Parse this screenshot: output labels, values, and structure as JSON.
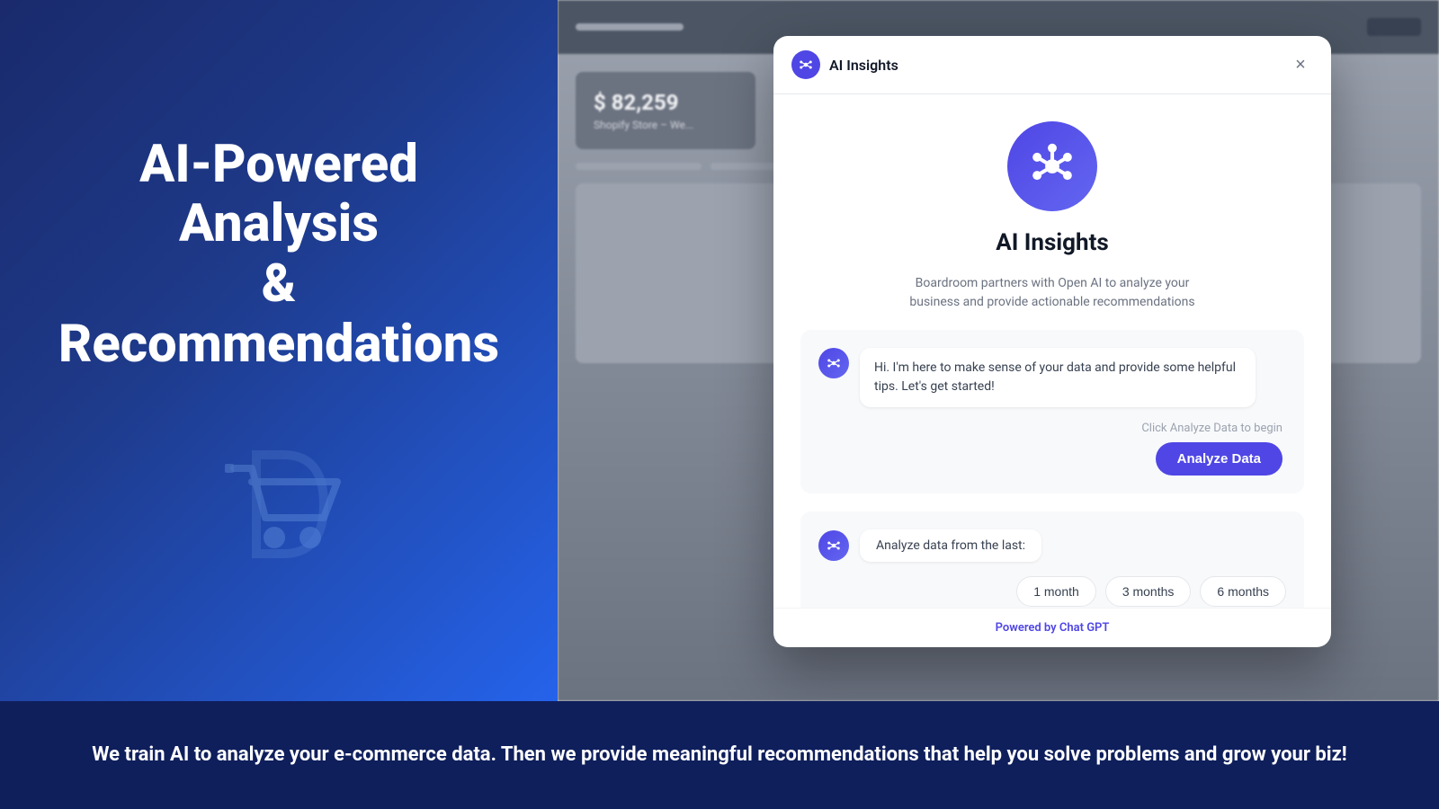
{
  "left_panel": {
    "heading_line1": "AI-Powered",
    "heading_line2": "Analysis",
    "heading_line3": "&",
    "heading_line4": "Recommendations"
  },
  "modal": {
    "header": {
      "title": "AI Insights",
      "close_label": "×"
    },
    "icon_alt": "ai-insights-icon",
    "main_title": "AI Insights",
    "subtitle": "Boardroom partners with Open AI to analyze your business and provide actionable recommendations",
    "chat_message_1": "Hi. I'm here to make sense of your data and provide some helpful tips. Let's get started!",
    "click_hint": "Click Analyze Data to begin",
    "analyze_button": "Analyze Data",
    "chat_message_2": "Analyze data from the last:",
    "time_buttons": [
      {
        "label": "1 month"
      },
      {
        "label": "3 months"
      },
      {
        "label": "6 months"
      }
    ],
    "footer_prefix": "Powered by ",
    "footer_brand": "Chat GPT"
  },
  "background": {
    "metric_value": "$ 82,259",
    "metric_label": "Shopify Store – We..."
  },
  "bottom_bar": {
    "text": "We train AI to analyze your e-commerce data. Then we provide meaningful recommendations that help you solve problems and grow your biz!"
  }
}
